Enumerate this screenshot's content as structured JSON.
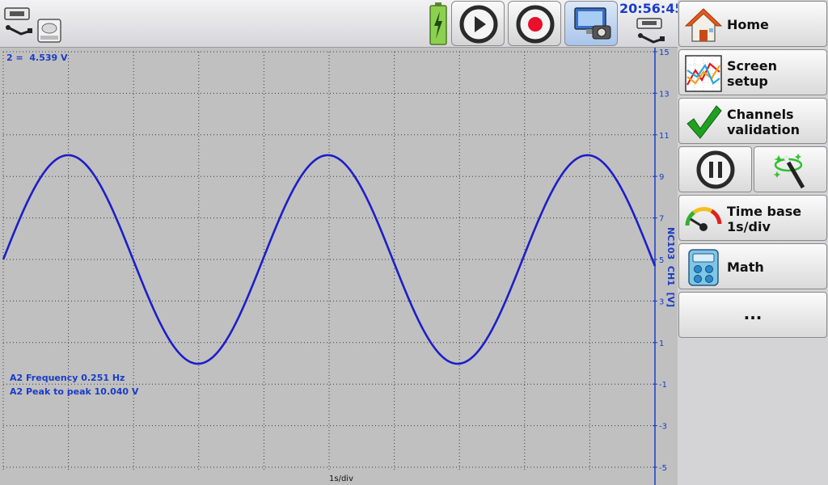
{
  "status_bar": {
    "clock": "20:56:45"
  },
  "toolbar": {
    "icons": [
      "usb-icon",
      "disk-drive-icon",
      "battery-charging-icon",
      "play-icon",
      "record-icon",
      "screenshot-camera-icon",
      "usb-icon"
    ]
  },
  "plot": {
    "cursor_readout": "2 =  4.539 V",
    "measurement_frequency": "A2 Frequency 0.251 Hz",
    "measurement_peak_to_peak": "A2 Peak to peak 10.040 V",
    "timebase_label": "1s/div",
    "axis_label": "NC103  CH1  [V]",
    "y_ticks": [
      "15",
      "13",
      "11",
      "9",
      "7",
      "5",
      "3",
      "1",
      "-1",
      "-3",
      "-5"
    ],
    "trace_color": "#1e1ec8",
    "grid_color": "#3a3a3a"
  },
  "chart_data": {
    "type": "line",
    "series": [
      {
        "name": "A2",
        "frequency_hz": 0.251,
        "min_v": -0.02,
        "max_v": 10.02,
        "peak_to_peak_v": 10.04
      }
    ],
    "x_div_unit": "1s/div",
    "ylim": [
      -5,
      15
    ],
    "y_ticks": [
      15,
      13,
      11,
      9,
      7,
      5,
      3,
      1,
      -1,
      -3,
      -5
    ],
    "ylabel": "NC103  CH1  [V]",
    "grid": true
  },
  "sidebar": {
    "home_label": "Home",
    "screen_setup_label": "Screen\nsetup",
    "channels_validation_label": "Channels\nvalidation",
    "time_base_label": "Time base\n1s/div",
    "math_label": "Math",
    "more_label": "..."
  },
  "colors": {
    "accent_blue": "#1a3cc8",
    "record_red": "#e8102a",
    "check_green": "#20a020"
  }
}
